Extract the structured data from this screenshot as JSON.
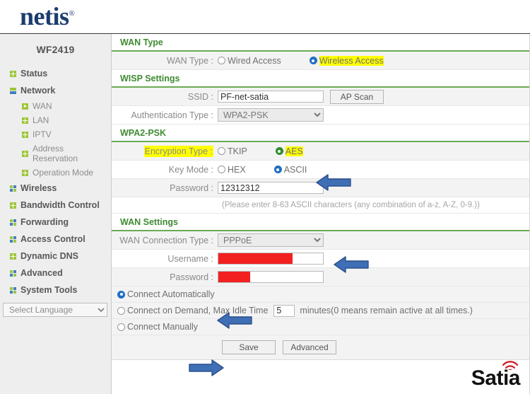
{
  "brand": {
    "name": "netis",
    "trademark": "®"
  },
  "sidebar": {
    "model": "WF2419",
    "items": [
      {
        "label": "Status",
        "icon": "plus-square-icon",
        "type": "main"
      },
      {
        "label": "Network",
        "icon": "bars-icon",
        "type": "main"
      },
      {
        "label": "WAN",
        "icon": "arrow-square-icon",
        "type": "sub"
      },
      {
        "label": "LAN",
        "icon": "plus-square-icon",
        "type": "sub"
      },
      {
        "label": "IPTV",
        "icon": "plus-square-icon",
        "type": "sub"
      },
      {
        "label": "Address Reservation",
        "icon": "plus-square-icon",
        "type": "sub"
      },
      {
        "label": "Operation Mode",
        "icon": "plus-square-icon",
        "type": "sub"
      },
      {
        "label": "Wireless",
        "icon": "grid-icon",
        "type": "main"
      },
      {
        "label": "Bandwidth Control",
        "icon": "plus-square-icon",
        "type": "main"
      },
      {
        "label": "Forwarding",
        "icon": "grid-icon",
        "type": "main"
      },
      {
        "label": "Access Control",
        "icon": "grid-icon",
        "type": "main"
      },
      {
        "label": "Dynamic DNS",
        "icon": "plus-square-icon",
        "type": "main"
      },
      {
        "label": "Advanced",
        "icon": "grid-icon",
        "type": "main"
      },
      {
        "label": "System Tools",
        "icon": "grid-icon",
        "type": "main"
      }
    ],
    "language": {
      "selected": "Select Language"
    }
  },
  "sections": {
    "wan_type": {
      "title": "WAN Type",
      "label": "WAN Type :",
      "options": [
        {
          "label": "Wired Access",
          "selected": false,
          "highlight": false
        },
        {
          "label": "Wireless Access",
          "selected": true,
          "highlight": true
        }
      ]
    },
    "wisp": {
      "title": "WISP Settings",
      "ssid_label": "SSID :",
      "ssid_value": "PF-net-satia",
      "ap_scan_label": "AP Scan",
      "auth_label": "Authentication Type :",
      "auth_value": "WPA2-PSK"
    },
    "wpa2psk": {
      "title": "WPA2-PSK",
      "encryption_label": "Encryption Type :",
      "encryption_options": [
        {
          "label": "TKIP",
          "selected": false,
          "highlight": false
        },
        {
          "label": "AES",
          "selected": true,
          "highlight": true
        }
      ],
      "keymode_label": "Key Mode :",
      "keymode_options": [
        {
          "label": "HEX",
          "selected": false
        },
        {
          "label": "ASCII",
          "selected": true
        }
      ],
      "password_label": "Password :",
      "password_value": "12312312",
      "hint": "(Please enter 8-63 ASCII characters (any combination of a-z, A-Z, 0-9.))"
    },
    "wan_settings": {
      "title": "WAN Settings",
      "conn_type_label": "WAN Connection Type :",
      "conn_type_value": "PPPoE",
      "username_label": "Username :",
      "username_value": "",
      "password_label": "Password :",
      "password_value": "",
      "modes": [
        {
          "label": "Connect Automatically",
          "selected": true
        },
        {
          "label": "Connect on Demand, Max Idle Time",
          "selected": false,
          "idle_value": "5",
          "suffix": "minutes(0 means remain active at all times.)"
        },
        {
          "label": "Connect Manually",
          "selected": false
        }
      ],
      "save_label": "Save",
      "advanced_label": "Advanced"
    }
  },
  "watermark": {
    "text": "Satia"
  },
  "colors": {
    "brand_navy": "#1b3d6d",
    "section_green": "#3f8a32",
    "rule_green": "#6aab54",
    "radio_blue": "#1f6fc4",
    "radio_green": "#2f8a2f",
    "highlight_yellow": "#ffff00",
    "redact_red": "#f22020",
    "arrow_blue": "#3f6fb5",
    "sidebar_bg": "#eeeeee"
  }
}
